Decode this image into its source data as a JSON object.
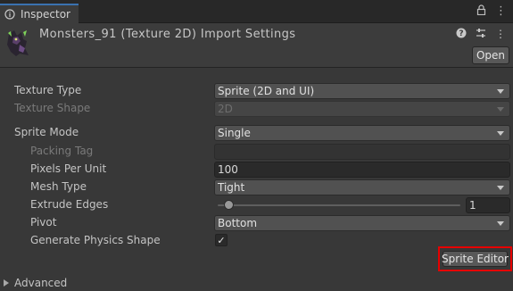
{
  "tab": {
    "label": "Inspector",
    "icon": "info-icon",
    "tools": [
      "lock-icon",
      "menu-icon"
    ]
  },
  "header": {
    "title": "Monsters_91 (Texture 2D) Import Settings",
    "thumbnail": "sprite-thumbnail",
    "icons": [
      "help-icon",
      "presets-icon",
      "menu-icon"
    ],
    "open_label": "Open"
  },
  "properties": {
    "texture_type": {
      "label": "Texture Type",
      "value": "Sprite (2D and UI)"
    },
    "texture_shape": {
      "label": "Texture Shape",
      "value": "2D"
    },
    "sprite_mode": {
      "label": "Sprite Mode",
      "value": "Single"
    },
    "packing_tag": {
      "label": "Packing Tag",
      "value": ""
    },
    "pixels_per_unit": {
      "label": "Pixels Per Unit",
      "value": "100"
    },
    "mesh_type": {
      "label": "Mesh Type",
      "value": "Tight"
    },
    "extrude_edges": {
      "label": "Extrude Edges",
      "value": "1",
      "slider_fraction": 0.031
    },
    "pivot": {
      "label": "Pivot",
      "value": "Bottom"
    },
    "generate_physics_shape": {
      "label": "Generate Physics Shape",
      "checked": true
    }
  },
  "buttons": {
    "sprite_editor": "Sprite Editor"
  },
  "advanced": {
    "label": "Advanced",
    "expanded": false
  },
  "colors": {
    "background": "#383838",
    "tab_accent": "#3a72b0",
    "highlight_border": "#e60000"
  }
}
